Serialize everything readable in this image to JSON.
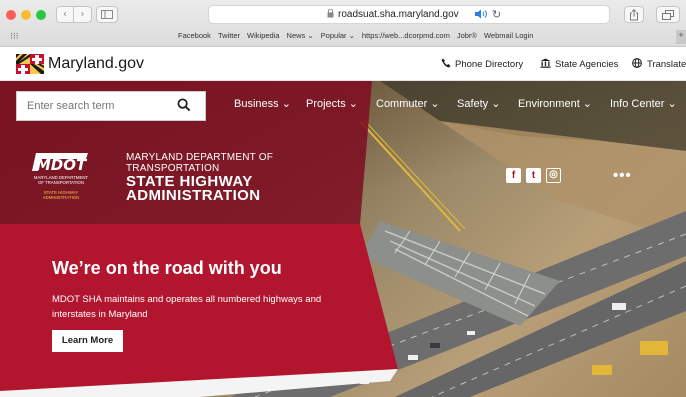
{
  "browser": {
    "url": "roadsuat.sha.maryland.gov",
    "back_glyph": "‹",
    "forward_glyph": "›",
    "grid_glyph": "⁝⁝⁝",
    "bookmarks": [
      "Facebook",
      "Twitter",
      "Wikipedia",
      "News ⌄",
      "Popular ⌄",
      "https://web...dcorpmd.com",
      "Jobr®",
      "Webmail Login"
    ],
    "plus_glyph": "+"
  },
  "maryland_bar": {
    "title": "Maryland.gov",
    "phone_directory": "Phone Directory",
    "state_agencies": "State Agencies",
    "translate": "Translate"
  },
  "search": {
    "placeholder": "Enter search term"
  },
  "nav": {
    "items": [
      "Business ⌄",
      "Projects ⌄",
      "Commuter ⌄",
      "Safety ⌄",
      "Environment ⌄",
      "Info Center ⌄"
    ]
  },
  "brand": {
    "logo_text": "MDOT",
    "logo_sub1": "MARYLAND DEPARTMENT",
    "logo_sub2": "OF TRANSPORTATION",
    "logo_sub3": "STATE HIGHWAY",
    "logo_sub4": "ADMINISTRATION",
    "line1": "MARYLAND DEPARTMENT OF",
    "line2": "TRANSPORTATION",
    "line3": "STATE HIGHWAY",
    "line4": "ADMINISTRATION"
  },
  "social": {
    "facebook": "f",
    "twitter": "t",
    "instagram": "◎",
    "more": "•••"
  },
  "hero": {
    "heading": "We’re on the road with you",
    "body": "MDOT SHA maintains and operates all numbered highways and interstates in Maryland",
    "button": "Learn More"
  },
  "colors": {
    "primary_red": "#a4152c",
    "dark_red": "#7e0f22",
    "brand_red": "#b2162f",
    "gold": "#f7c64b"
  }
}
